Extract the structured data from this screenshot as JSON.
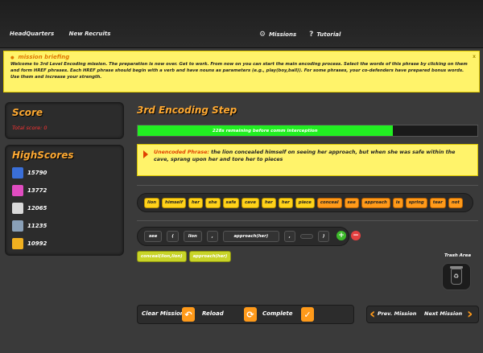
{
  "nav": {
    "left": [
      "HeadQuarters",
      "New Recruits"
    ],
    "missions": "Missions",
    "tutorial": "Tutorial"
  },
  "briefing": {
    "title": "mission briefing",
    "text": "Welcome to 3rd Level Encoding mission. The preparation is now over. Get to work. From now on you can start the main encoding process. Select the words of this phrase by clicking on them and form HREF phrases. Each HREF phrase should begin with a verb and have nouns as parameters (e.g., play(boy,ball)). For some phrases, your co-defenders have prepared bonus words. Use them and increase your strength.",
    "close": "x"
  },
  "score": {
    "title": "Score",
    "total_label": "Total score: 0"
  },
  "highscores": {
    "title": "HighScores",
    "items": [
      {
        "score": "15790",
        "color": "#3a6fd8"
      },
      {
        "score": "13772",
        "color": "#e04cc0"
      },
      {
        "score": "12065",
        "color": "#d9d9d9"
      },
      {
        "score": "11235",
        "color": "#8aa0b8"
      },
      {
        "score": "10992",
        "color": "#f0b020"
      }
    ]
  },
  "step": {
    "title": "3rd Encoding Step",
    "progress_text": "228s remaining before comm interception",
    "progress_fraction": 0.75
  },
  "phrase": {
    "label": "Unencoded Phrase:",
    "text": "the lion concealed himself on seeing her approach, but when she was safe within the cave, sprang upon her and tore her to pieces"
  },
  "words": [
    {
      "text": "lion",
      "style": "yellow"
    },
    {
      "text": "himself",
      "style": "yellow"
    },
    {
      "text": "her",
      "style": "yellow"
    },
    {
      "text": "she",
      "style": "yellow"
    },
    {
      "text": "safe",
      "style": "yellow"
    },
    {
      "text": "cave",
      "style": "yellow"
    },
    {
      "text": "her",
      "style": "yellow"
    },
    {
      "text": "her",
      "style": "yellow"
    },
    {
      "text": "piece",
      "style": "yellow"
    },
    {
      "text": "conceal",
      "style": "orange"
    },
    {
      "text": "see",
      "style": "orange"
    },
    {
      "text": "approach",
      "style": "orange"
    },
    {
      "text": "is",
      "style": "orange"
    },
    {
      "text": "spring",
      "style": "orange"
    },
    {
      "text": "tear",
      "style": "orange"
    },
    {
      "text": "not",
      "style": "orange"
    }
  ],
  "code_slots": [
    "see",
    "(",
    "lion",
    ",",
    "approach(her)",
    ",",
    "",
    ")"
  ],
  "code_buttons": {
    "add": "+",
    "remove": "−"
  },
  "bonus": [
    "conceal(lion,lion)",
    "approach(her)"
  ],
  "trash": {
    "label": "Trash Area"
  },
  "actions": {
    "clear": "Clear Mission",
    "reload": "Reload",
    "complete": "Complete"
  },
  "pager": {
    "prev": "Prev. Mission",
    "next": "Next Mission"
  }
}
